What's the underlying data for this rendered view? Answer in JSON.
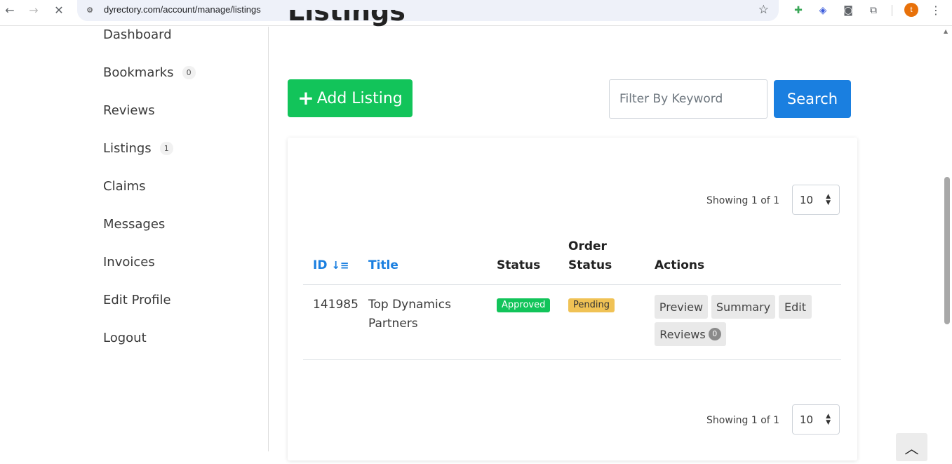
{
  "browser": {
    "url": "dyrectory.com/account/manage/listings",
    "avatar_letter": "t",
    "icons": [
      "back-arrow-icon",
      "forward-arrow-icon",
      "close-icon",
      "site-settings-icon",
      "star-icon",
      "extension-icon",
      "shield-extension-icon",
      "camera-icon",
      "puzzle-icon",
      "kebab-menu-icon"
    ]
  },
  "sidebar": {
    "items": [
      {
        "label": "Dashboard",
        "count": null
      },
      {
        "label": "Bookmarks",
        "count": "0"
      },
      {
        "label": "Reviews",
        "count": null
      },
      {
        "label": "Listings",
        "count": "1"
      },
      {
        "label": "Claims",
        "count": null
      },
      {
        "label": "Messages",
        "count": null
      },
      {
        "label": "Invoices",
        "count": null
      },
      {
        "label": "Edit Profile",
        "count": null
      },
      {
        "label": "Logout",
        "count": null
      }
    ]
  },
  "main": {
    "heading": "Listings",
    "add_label": "Add Listing",
    "filter_placeholder": "Filter By Keyword",
    "search_label": "Search",
    "showing_top": "Showing 1 of 1",
    "showing_bottom": "Showing 1 of 1",
    "per_page": "10",
    "columns": {
      "id": "ID",
      "title": "Title",
      "status": "Status",
      "order_status_line1": "Order",
      "order_status_line2": "Status",
      "actions": "Actions"
    },
    "rows": [
      {
        "id": "141985",
        "title_line1": "Top Dynamics",
        "title_line2": "Partners",
        "status": "Approved",
        "order_status": "Pending",
        "actions": {
          "preview": "Preview",
          "summary": "Summary",
          "edit": "Edit",
          "reviews": "Reviews",
          "reviews_count": "0"
        }
      }
    ]
  },
  "colors": {
    "green": "#12c45a",
    "blue": "#1a7fe0",
    "pending": "#f0c255"
  }
}
